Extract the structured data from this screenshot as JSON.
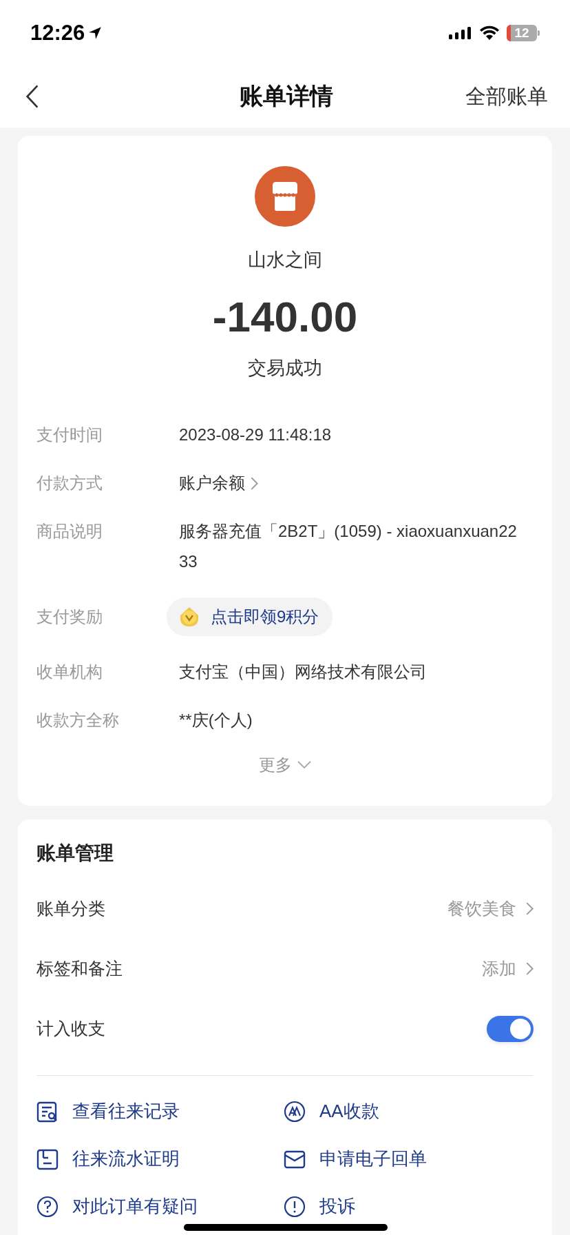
{
  "status_bar": {
    "time": "12:26",
    "battery": "12"
  },
  "nav": {
    "title": "账单详情",
    "action": "全部账单"
  },
  "summary": {
    "merchant": "山水之间",
    "amount": "-140.00",
    "status": "交易成功"
  },
  "details": [
    {
      "kind": "text",
      "label": "支付时间",
      "value": "2023-08-29 11:48:18"
    },
    {
      "kind": "link",
      "label": "付款方式",
      "value": "账户余额"
    },
    {
      "kind": "text",
      "label": "商品说明",
      "value": "服务器充值「2B2T」(1059) - xiaoxuanxuan2233"
    },
    {
      "kind": "reward",
      "label": "支付奖励",
      "value": "点击即领9积分"
    },
    {
      "kind": "text",
      "label": "收单机构",
      "value": "支付宝（中国）网络技术有限公司"
    },
    {
      "kind": "text",
      "label": "收款方全称",
      "value": "**庆(个人)"
    }
  ],
  "more": "更多",
  "management": {
    "title": "账单管理",
    "rows": [
      {
        "kind": "link",
        "label": "账单分类",
        "value": "餐饮美食"
      },
      {
        "kind": "link",
        "label": "标签和备注",
        "value": "添加"
      },
      {
        "kind": "switch",
        "label": "计入收支",
        "on": true
      }
    ]
  },
  "actions": [
    "查看往来记录",
    "AA收款",
    "往来流水证明",
    "申请电子回单",
    "对此订单有疑问",
    "投诉"
  ]
}
